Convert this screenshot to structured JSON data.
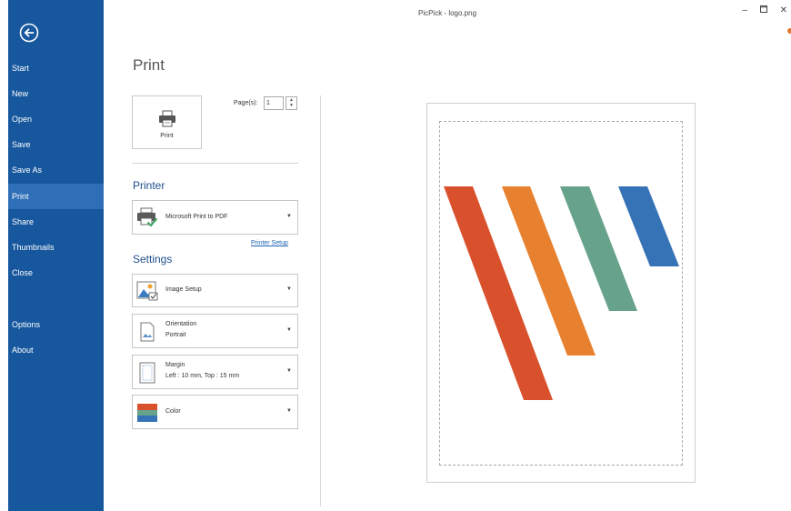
{
  "window": {
    "title": "PicPick - logo.png",
    "minimize_icon": "minimize-icon",
    "maximize_icon": "maximize-icon",
    "close_icon": "close-icon"
  },
  "sidebar": {
    "back_icon": "back-arrow-icon",
    "items": [
      {
        "label": "Start"
      },
      {
        "label": "New"
      },
      {
        "label": "Open"
      },
      {
        "label": "Save"
      },
      {
        "label": "Save As"
      },
      {
        "label": "Print",
        "active": true
      },
      {
        "label": "Share"
      },
      {
        "label": "Thumbnails"
      },
      {
        "label": "Close"
      },
      {
        "label": "Options"
      },
      {
        "label": "About"
      }
    ]
  },
  "main": {
    "heading": "Print",
    "print_button_label": "Print",
    "pages_label": "Page(s):",
    "pages_value": "1",
    "printer_section": "Printer",
    "printer_name": "Microsoft Print to PDF",
    "printer_setup_link": "Printer Setup",
    "settings_section": "Settings",
    "settings": {
      "image_setup": "Image Setup",
      "orientation_label": "Orientation",
      "orientation_value": "Portrait",
      "margin_label": "Margin",
      "margin_value": "Left : 10 mm, Top : 15 mm",
      "color": "Color"
    }
  },
  "colors": {
    "sidebar": "#16579e",
    "sidebar_active": "#2f6fb7",
    "logo_red": "#d9512c",
    "logo_orange": "#e8812f",
    "logo_green": "#67a28b",
    "logo_blue": "#3672b6"
  }
}
